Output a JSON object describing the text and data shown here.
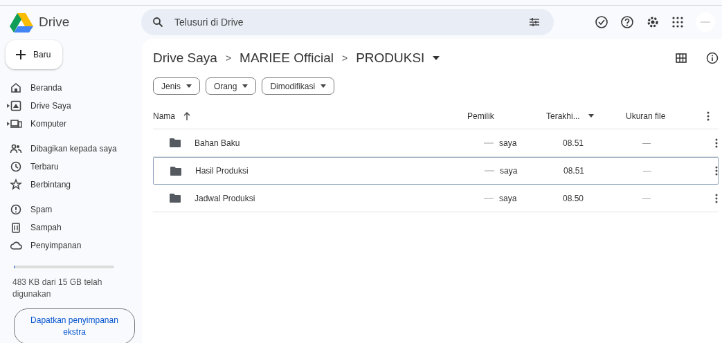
{
  "app": {
    "name": "Drive"
  },
  "search": {
    "placeholder": "Telusuri di Drive"
  },
  "new_button": {
    "label": "Baru"
  },
  "sidebar": {
    "groups": [
      [
        {
          "label": "Beranda",
          "expandable": false
        },
        {
          "label": "Drive Saya",
          "expandable": true
        },
        {
          "label": "Komputer",
          "expandable": true
        }
      ],
      [
        {
          "label": "Dibagikan kepada saya",
          "expandable": false
        },
        {
          "label": "Terbaru",
          "expandable": false
        },
        {
          "label": "Berbintang",
          "expandable": false
        }
      ],
      [
        {
          "label": "Spam",
          "expandable": false
        },
        {
          "label": "Sampah",
          "expandable": false
        },
        {
          "label": "Penyimpanan",
          "expandable": false
        }
      ]
    ]
  },
  "storage": {
    "level": 0.01,
    "text": "483 KB dari 15 GB telah digunakan",
    "button": "Dapatkan penyimpanan ekstra"
  },
  "breadcrumb": [
    "Drive Saya",
    "MARIEE Official",
    "PRODUKSI"
  ],
  "breadcrumb_separator": ">",
  "filters": [
    "Jenis",
    "Orang",
    "Dimodifikasi"
  ],
  "table": {
    "columns": [
      "Nama",
      "Pemilik",
      "Terakhi...",
      "Ukuran file"
    ],
    "rows": [
      {
        "name": "Bahan Baku",
        "owner": "saya",
        "modified": "08.51",
        "size": "—",
        "selected": false
      },
      {
        "name": "Hasil Produksi",
        "owner": "saya",
        "modified": "08.51",
        "size": "—",
        "selected": true
      },
      {
        "name": "Jadwal Produksi",
        "owner": "saya",
        "modified": "08.50",
        "size": "—",
        "selected": false
      }
    ]
  }
}
